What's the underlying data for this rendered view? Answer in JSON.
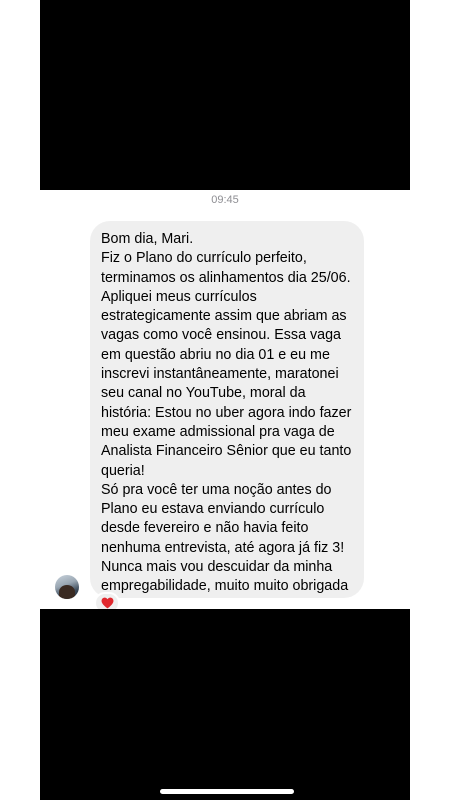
{
  "conversation": {
    "timestamp": "09:45",
    "message": {
      "paragraphs": [
        "Bom dia, Mari.",
        "Fiz o Plano do currículo perfeito, terminamos os alinhamentos dia 25/06. Apliquei meus currículos estrategicamente assim que abriam as vagas como você ensinou. Essa vaga em questão abriu no dia 01 e eu me inscrevi instantâneamente, maratonei seu canal no YouTube, moral da história: Estou no uber agora indo fazer meu exame admissional pra vaga de Analista Financeiro Sênior que eu tanto queria!",
        "Só pra você ter uma noção antes do Plano eu estava enviando currículo desde fevereiro e não havia feito nenhuma entrevista, até agora já fiz 3! Nunca mais vou descuidar da minha empregabilidade, muito muito obrigada por tudo!"
      ],
      "reaction": "heart-icon"
    }
  },
  "colors": {
    "bubble_background": "#efefef",
    "timestamp_text": "#8e8e93",
    "reaction_heart": "#e0282e",
    "media_placeholder": "#000000"
  }
}
